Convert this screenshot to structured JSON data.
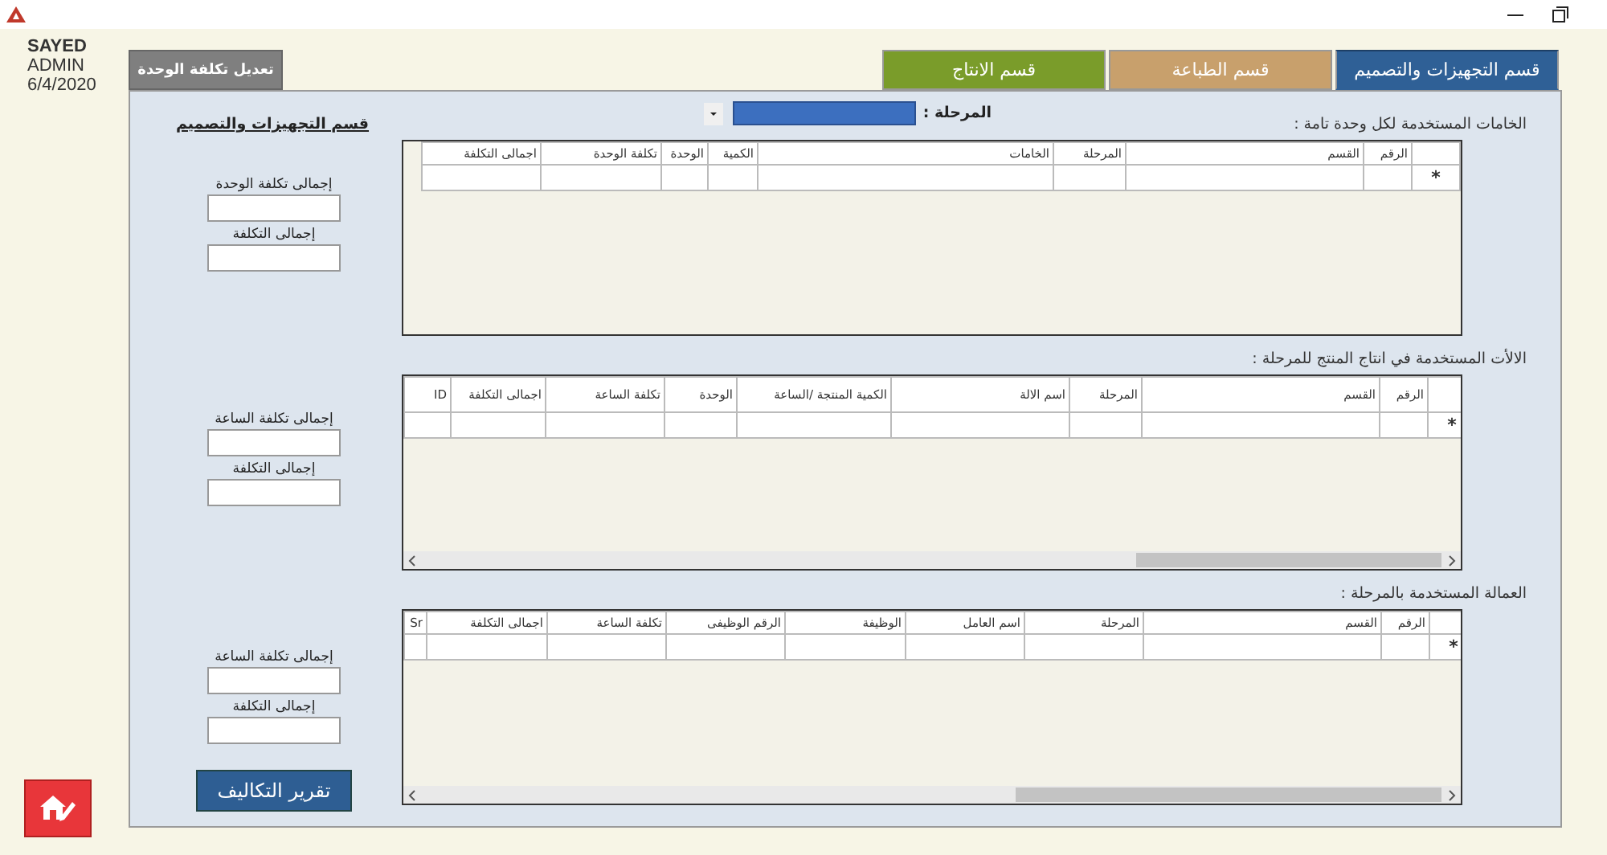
{
  "user": {
    "name": "SAYED",
    "role": "ADMIN",
    "date": "6/4/2020"
  },
  "edit_tab": {
    "label": "تعديل تكلفة الوحدة"
  },
  "department_tabs": [
    {
      "label": "قسم التجهيزات والتصميم",
      "selected": true,
      "color": "#2f6096"
    },
    {
      "label": "قسم الطباعة",
      "selected": false,
      "color": "#c8a06c"
    },
    {
      "label": "قسم الانتاج",
      "selected": false,
      "color": "#7a9c2a"
    }
  ],
  "stage": {
    "label": "المرحلة :"
  },
  "sidebar": {
    "title": "قسم التجهيزات والتصميم",
    "groups": [
      {
        "fields": [
          {
            "label": "إجمالى تكلفة الوحدة"
          },
          {
            "label": "إجمالى التكلفة"
          }
        ]
      },
      {
        "fields": [
          {
            "label": "إجمالى تكلفة الساعة"
          },
          {
            "label": "إجمالى التكلفة"
          }
        ]
      },
      {
        "fields": [
          {
            "label": "إجمالى تكلفة الساعة"
          },
          {
            "label": "إجمالى التكلفة"
          }
        ]
      }
    ]
  },
  "report_button": {
    "label": "تقرير التكاليف"
  },
  "grids": [
    {
      "caption": "الخامات المستخدمة لكل وحدة تامة :",
      "new_row_marker": "*",
      "scrollbar": false,
      "columns": [
        "الرقم",
        "القسم",
        "المرحلة",
        "الخامات",
        "الكمية",
        "الوحدة",
        "تكلفة الوحدة",
        "اجمالى التكلفة"
      ]
    },
    {
      "caption": "الالأت المستخدمة في انتاج المنتج للمرحلة :",
      "new_row_marker": "*",
      "scrollbar": true,
      "columns": [
        "الرقم",
        "القسم",
        "المرحلة",
        "اسم الالة",
        "الكمية المنتجة /الساعة",
        "الوحدة",
        "تكلفة الساعة",
        "اجمالى التكلفة",
        "ID"
      ]
    },
    {
      "caption": "العمالة المستخدمة بالمرحلة :",
      "new_row_marker": "*",
      "scrollbar": true,
      "columns": [
        "الرقم",
        "القسم",
        "المرحلة",
        "اسم العامل",
        "الوظيفة",
        "الرقم الوظيفى",
        "تكلفة الساعة",
        "اجمالى التكلفة",
        "Sr"
      ]
    }
  ]
}
